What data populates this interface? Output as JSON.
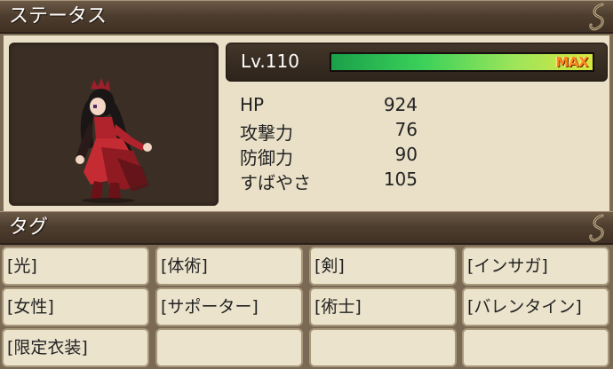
{
  "status_header": {
    "title": "ステータス"
  },
  "level": {
    "label": "Lv.110",
    "exp_fraction": 1.0,
    "max_label": "MAX"
  },
  "stats": [
    {
      "label": "HP",
      "value": "924"
    },
    {
      "label": "攻撃力",
      "value": "76"
    },
    {
      "label": "防御力",
      "value": "90"
    },
    {
      "label": "すばやさ",
      "value": "105"
    }
  ],
  "tags_header": {
    "title": "タグ"
  },
  "tags": [
    "[光]",
    "[体術]",
    "[剣]",
    "[インサガ]",
    "[女性]",
    "[サポーター]",
    "[術士]",
    "[バレンタイン]",
    "[限定衣装]",
    "",
    "",
    ""
  ],
  "colors": {
    "header": "#4e3e2f",
    "panel": "#e9e0c7",
    "tag_bg": "#ebe3cc",
    "exp_start": "#1aa04a",
    "exp_end": "#d8e640",
    "max_text": "#ff8a1e"
  },
  "icons": {
    "header_ornament": "scroll-flourish-icon",
    "portrait": "character-sprite"
  }
}
